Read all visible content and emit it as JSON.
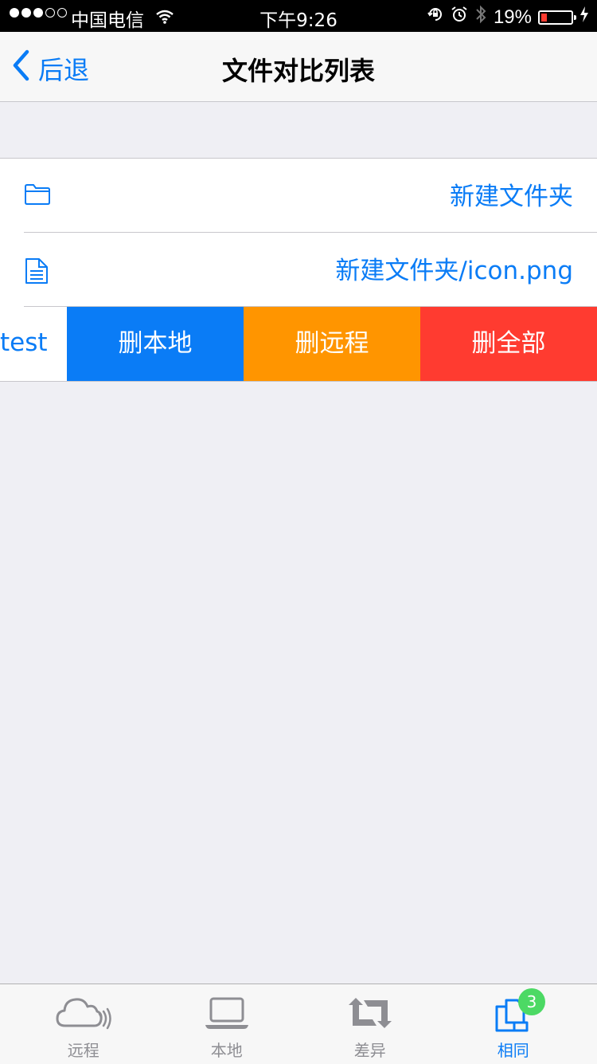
{
  "status_bar": {
    "carrier": "中国电信",
    "time": "下午9:26",
    "battery_percent": "19%",
    "battery_level": 0.19,
    "signal_bars": 3,
    "icons": [
      "wifi-icon",
      "rotation-lock-icon",
      "alarm-icon",
      "bluetooth-icon",
      "charging-icon"
    ]
  },
  "nav": {
    "back_label": "后退",
    "title": "文件对比列表"
  },
  "rows": [
    {
      "icon": "folder-icon",
      "path": "新建文件夹"
    },
    {
      "icon": "document-icon",
      "path": "新建文件夹/icon.png"
    },
    {
      "path_visible": "test",
      "swiped": true
    }
  ],
  "swipe_actions": {
    "delete_local": "删本地",
    "delete_remote": "删远程",
    "delete_all": "删全部"
  },
  "tabs": [
    {
      "label": "远程",
      "icon": "cloud-icon",
      "active": false
    },
    {
      "label": "本地",
      "icon": "laptop-icon",
      "active": false
    },
    {
      "label": "差异",
      "icon": "sync-icon",
      "active": false
    },
    {
      "label": "相同",
      "icon": "files-icon",
      "active": true,
      "badge": "3"
    }
  ],
  "colors": {
    "accent": "#0a7cf6",
    "orange": "#ff9500",
    "red": "#ff3b30",
    "badge_green": "#4cd964",
    "background": "#efeff4"
  }
}
